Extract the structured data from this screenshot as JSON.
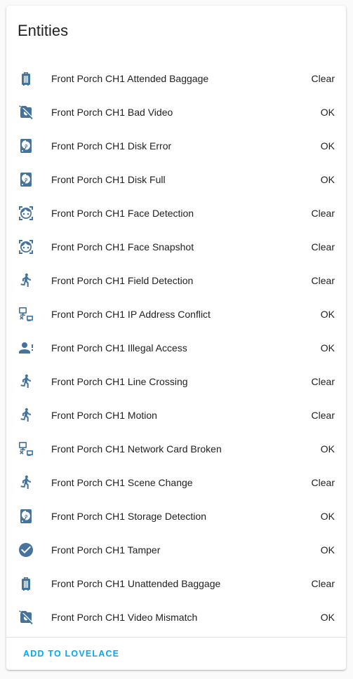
{
  "card": {
    "title": "Entities",
    "action_label": "ADD TO LOVELACE"
  },
  "colors": {
    "icon": "#44739e",
    "accent": "#03a9f4",
    "text": "#212121"
  },
  "entities": [
    {
      "icon": "baggage-icon",
      "name": "Front Porch CH1 Attended Baggage",
      "state": "Clear"
    },
    {
      "icon": "video-off-icon",
      "name": "Front Porch CH1 Bad Video",
      "state": "OK"
    },
    {
      "icon": "harddisk-icon",
      "name": "Front Porch CH1 Disk Error",
      "state": "OK"
    },
    {
      "icon": "harddisk-icon",
      "name": "Front Porch CH1 Disk Full",
      "state": "OK"
    },
    {
      "icon": "face-recognition-icon",
      "name": "Front Porch CH1 Face Detection",
      "state": "Clear"
    },
    {
      "icon": "face-recognition-icon",
      "name": "Front Porch CH1 Face Snapshot",
      "state": "Clear"
    },
    {
      "icon": "walk-icon",
      "name": "Front Porch CH1 Field Detection",
      "state": "Clear"
    },
    {
      "icon": "ip-network-off-icon",
      "name": "Front Porch CH1 IP Address Conflict",
      "state": "OK"
    },
    {
      "icon": "account-alert-icon",
      "name": "Front Porch CH1 Illegal Access",
      "state": "OK"
    },
    {
      "icon": "walk-icon",
      "name": "Front Porch CH1 Line Crossing",
      "state": "Clear"
    },
    {
      "icon": "walk-icon",
      "name": "Front Porch CH1 Motion",
      "state": "Clear"
    },
    {
      "icon": "ip-network-off-icon",
      "name": "Front Porch CH1 Network Card Broken",
      "state": "OK"
    },
    {
      "icon": "walk-icon",
      "name": "Front Porch CH1 Scene Change",
      "state": "Clear"
    },
    {
      "icon": "harddisk-icon",
      "name": "Front Porch CH1 Storage Detection",
      "state": "OK"
    },
    {
      "icon": "check-circle-icon",
      "name": "Front Porch CH1 Tamper",
      "state": "OK"
    },
    {
      "icon": "baggage-icon",
      "name": "Front Porch CH1 Unattended Baggage",
      "state": "Clear"
    },
    {
      "icon": "video-off-icon",
      "name": "Front Porch CH1 Video Mismatch",
      "state": "OK"
    }
  ]
}
